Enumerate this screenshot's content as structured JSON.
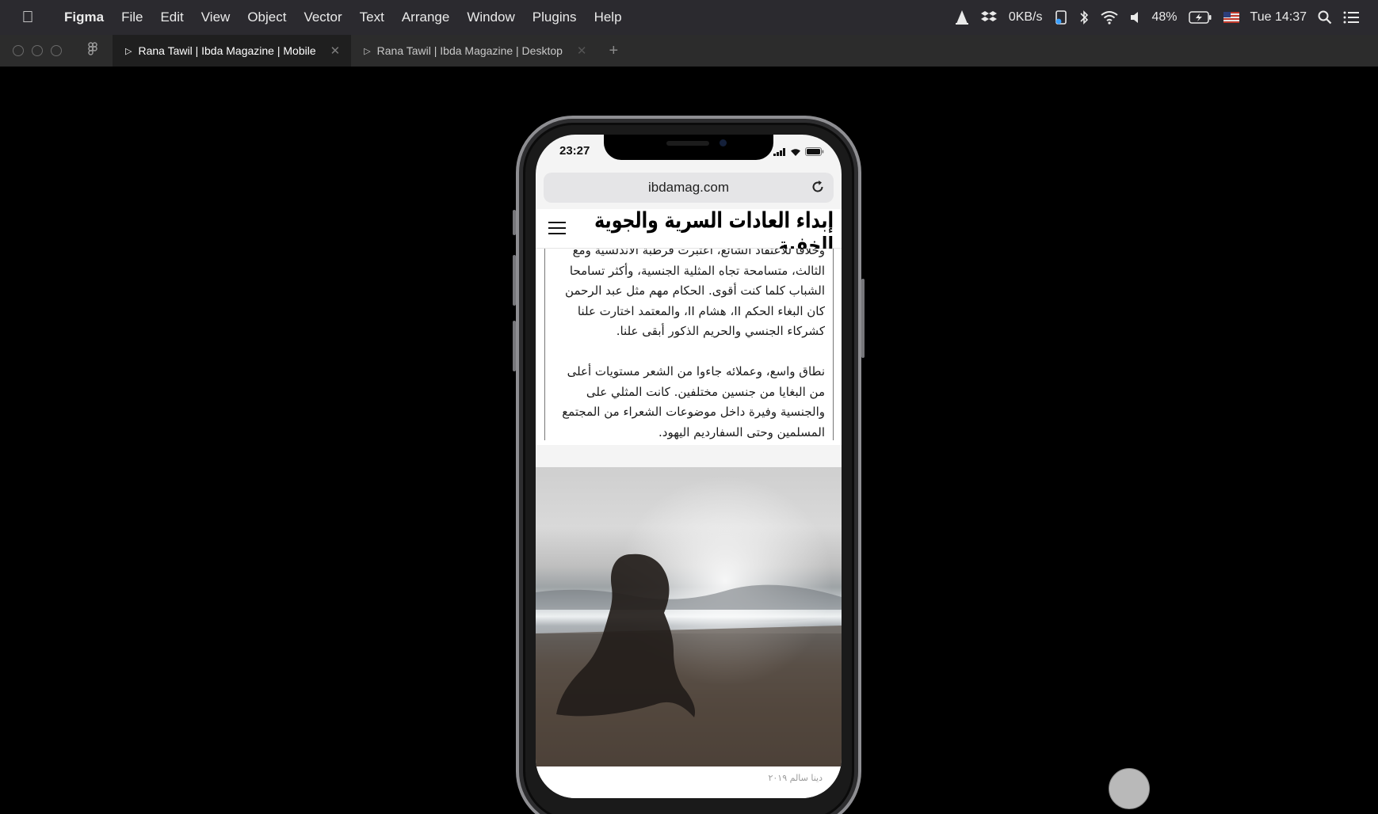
{
  "menubar": {
    "app_name": "Figma",
    "menus": [
      "File",
      "Edit",
      "View",
      "Object",
      "Vector",
      "Text",
      "Arrange",
      "Window",
      "Plugins",
      "Help"
    ],
    "network_speed": "0KB/s",
    "battery": "48%",
    "clock": "Tue 14:37"
  },
  "tabs": [
    {
      "label": "Rana Tawil | Ibda Magazine | Mobile",
      "active": true
    },
    {
      "label": "Rana Tawil | Ibda Magazine | Desktop",
      "active": false
    }
  ],
  "phone": {
    "time": "23:27",
    "url": "ibdamag.com",
    "site_title": "إبداء العادات السرية والجوية الخفية",
    "article": {
      "paragraph1": "وخلافا للاعتقاد الشائع، اعتبرت قرطبة الأندلسية ومع الثالث، متسامحة تجاه المثلية الجنسية، وأكثر تسامحا الشباب كلما كنت أقوى. الحكام مهم مثل عبد الرحمن كان البغاء الحكم II، هشام II، والمعتمد اختارت علنا كشركاء الجنسي والحريم الذكور أبقى علنا.",
      "paragraph2": "نطاق واسع، وعملائه جاءوا من الشعر مستويات أعلى من البغايا من جنسين مختلفين. كانت المثلي على والجنسية وفيرة داخل موضوعات الشعراء من المجتمع المسلمين وحتى السفارديم اليهود."
    },
    "photo_caption": "دينا سالم ٢٠١٩"
  },
  "colors": {
    "menubar_bg": "#2b2a2f",
    "tabbar_bg": "#2c2c2c",
    "canvas_bg": "#000000"
  }
}
